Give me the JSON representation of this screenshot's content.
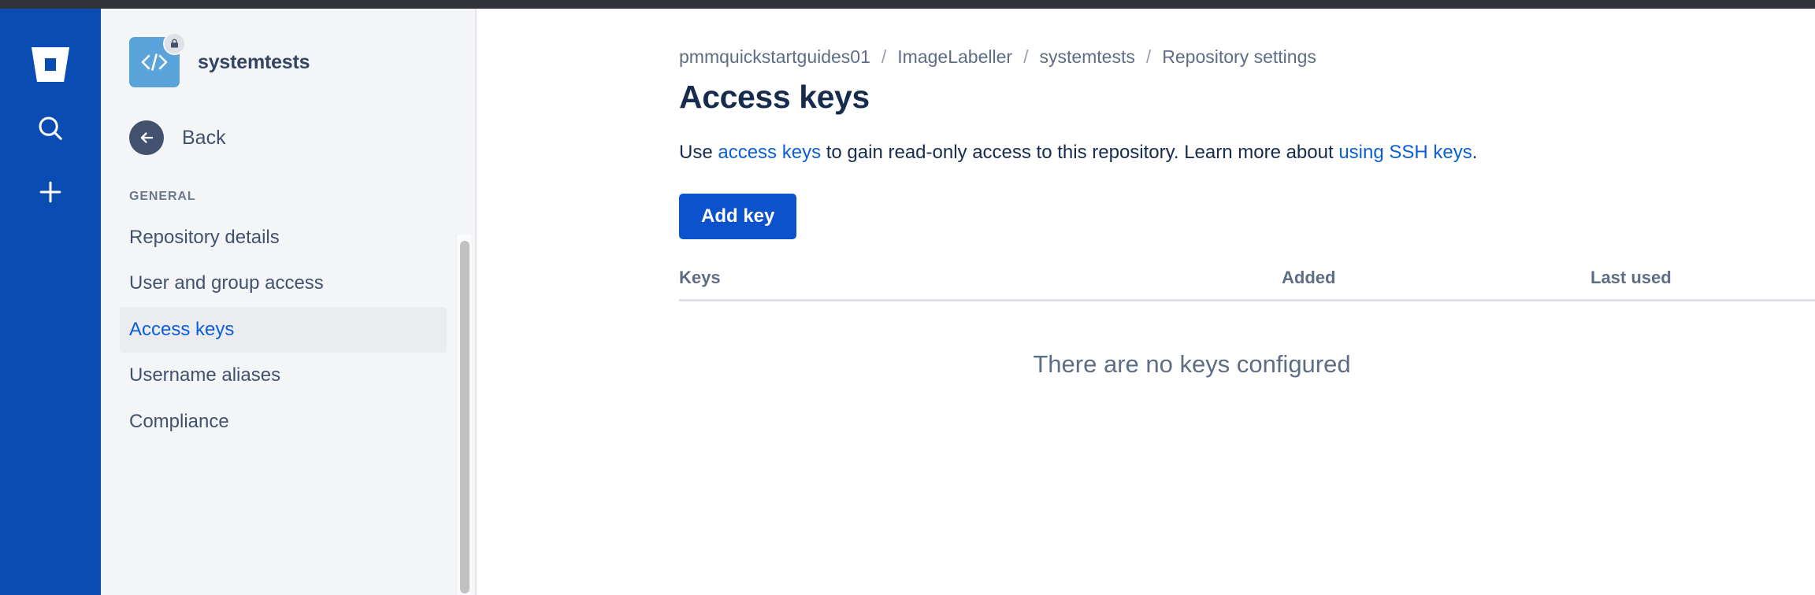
{
  "window": {
    "rail_color": "#0b4cb3",
    "sidebar_bg": "#f4f5f7",
    "accent_color": "#0b52cc",
    "link_color": "#0b5ed7"
  },
  "rail": {
    "logo_icon": "bitbucket-logo-icon",
    "items": [
      {
        "icon": "search-icon",
        "name": "search"
      },
      {
        "icon": "plus-icon",
        "name": "create"
      }
    ]
  },
  "sidebar": {
    "repo": {
      "name": "systemtests",
      "avatar_icon": "code-brackets-icon",
      "avatar_color": "#5ba4db",
      "badge_icon": "lock-icon"
    },
    "back": {
      "label": "Back",
      "icon": "arrow-left-icon"
    },
    "section_title": "GENERAL",
    "items": [
      {
        "label": "Repository details",
        "selected": false
      },
      {
        "label": "User and group access",
        "selected": false
      },
      {
        "label": "Access keys",
        "selected": true
      },
      {
        "label": "Username aliases",
        "selected": false
      },
      {
        "label": "Compliance",
        "selected": false
      }
    ]
  },
  "main": {
    "breadcrumb": [
      "pmmquickstartguides01",
      "ImageLabeller",
      "systemtests",
      "Repository settings"
    ],
    "breadcrumb_separator": "/",
    "page_title": "Access keys",
    "intro": {
      "part1": "Use ",
      "link1": "access keys",
      "part2": " to gain read-only access to this repository. Learn more about ",
      "link2": "using SSH keys",
      "part3": "."
    },
    "add_key_label": "Add key",
    "table": {
      "columns": [
        "Keys",
        "Added",
        "Last used"
      ],
      "rows": [],
      "empty_message": "There are no keys configured"
    }
  }
}
